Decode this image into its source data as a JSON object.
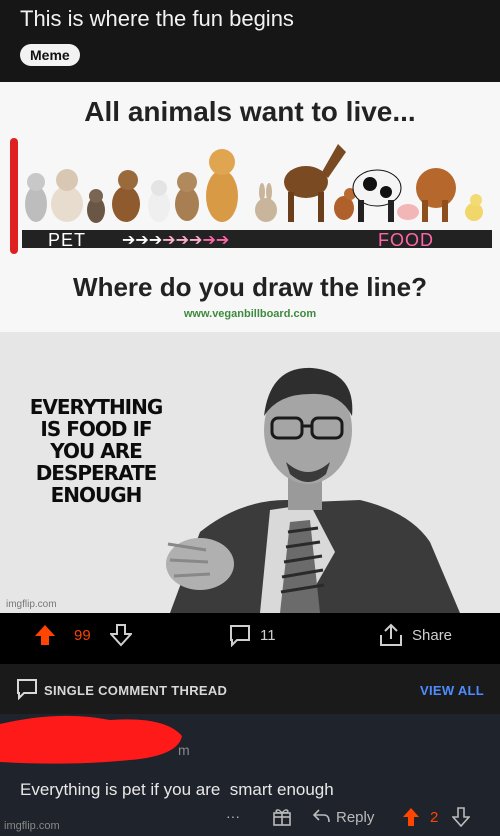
{
  "post": {
    "title": "This is where the fun begins",
    "flair": "Meme"
  },
  "meme": {
    "heading": "All animals want to live...",
    "pet_label": "PET",
    "food_label": "FOOD",
    "question": "Where do you draw the line?",
    "site": "www.veganbillboard.com",
    "caption_lines": [
      "EVERYTHING",
      "IS FOOD IF",
      "YOU ARE",
      "DESPERATE ENOUGH"
    ],
    "watermark": "imgflip.com"
  },
  "actions": {
    "upvotes": "99",
    "comments": "11",
    "share": "Share"
  },
  "thread": {
    "label": "SINGLE COMMENT THREAD",
    "view_all": "VIEW ALL"
  },
  "comment": {
    "author_tail": "m",
    "body": "Everything is pet if you are  smart enough",
    "more": "···",
    "reply": "Reply",
    "score": "2"
  },
  "footer_watermark": "imgflip.com",
  "colors": {
    "upvote": "#ff4500",
    "link": "#4d8dff",
    "redaction": "#ff1a1a",
    "comment_bg": "#1f232b"
  }
}
